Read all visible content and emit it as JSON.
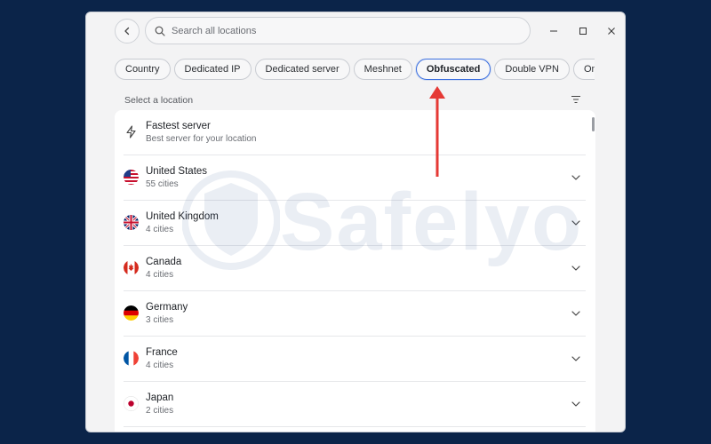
{
  "search": {
    "placeholder": "Search all locations"
  },
  "filters": [
    {
      "label": "Country",
      "active": false
    },
    {
      "label": "Dedicated IP",
      "active": false
    },
    {
      "label": "Dedicated server",
      "active": false
    },
    {
      "label": "Meshnet",
      "active": false
    },
    {
      "label": "Obfuscated",
      "active": true
    },
    {
      "label": "Double VPN",
      "active": false
    },
    {
      "label": "Onion O",
      "active": false
    }
  ],
  "section_label": "Select a location",
  "fastest": {
    "title": "Fastest server",
    "subtitle": "Best server for your location",
    "icon": "bolt-icon"
  },
  "countries": [
    {
      "name": "United States",
      "cities": "55 cities",
      "flag": "us-flag-icon"
    },
    {
      "name": "United Kingdom",
      "cities": "4 cities",
      "flag": "uk-flag-icon"
    },
    {
      "name": "Canada",
      "cities": "4 cities",
      "flag": "ca-flag-icon"
    },
    {
      "name": "Germany",
      "cities": "3 cities",
      "flag": "de-flag-icon"
    },
    {
      "name": "France",
      "cities": "4 cities",
      "flag": "fr-flag-icon"
    },
    {
      "name": "Japan",
      "cities": "2 cities",
      "flag": "jp-flag-icon"
    }
  ],
  "watermark": "Safelyo",
  "colors": {
    "background": "#0b2449",
    "accent": "#3b6fe0",
    "arrow": "#e53935"
  }
}
